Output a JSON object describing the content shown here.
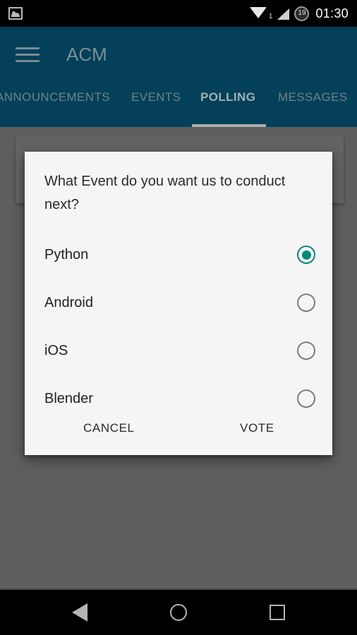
{
  "status_bar": {
    "notification_icon": "photo-icon",
    "wifi_icon": "wifi-icon",
    "sim_label": "1",
    "signal_icon": "signal-icon",
    "battery_level": "19",
    "time": "01:30"
  },
  "app_bar": {
    "menu_icon": "hamburger-menu-icon",
    "title": "ACM",
    "color": "#044059",
    "tabs": [
      {
        "label": "ANNOUNCEMENTS",
        "active": false
      },
      {
        "label": "EVENTS",
        "active": false
      },
      {
        "label": "POLLING",
        "active": true
      },
      {
        "label": "MESSAGES",
        "active": false
      }
    ]
  },
  "background_card": {
    "text": "What Event do you want us to conduct next?"
  },
  "dialog": {
    "title": "What Event do you want us to conduct next?",
    "selected_option": "Python",
    "accent_color": "#00897b",
    "options": [
      {
        "label": "Python",
        "checked": true
      },
      {
        "label": "Android",
        "checked": false
      },
      {
        "label": "iOS",
        "checked": false
      },
      {
        "label": "Blender",
        "checked": false
      }
    ],
    "cancel_label": "CANCEL",
    "confirm_label": "VOTE"
  },
  "nav_bar": {
    "back_label": "back-icon",
    "home_label": "home-icon",
    "recents_label": "recents-icon"
  }
}
